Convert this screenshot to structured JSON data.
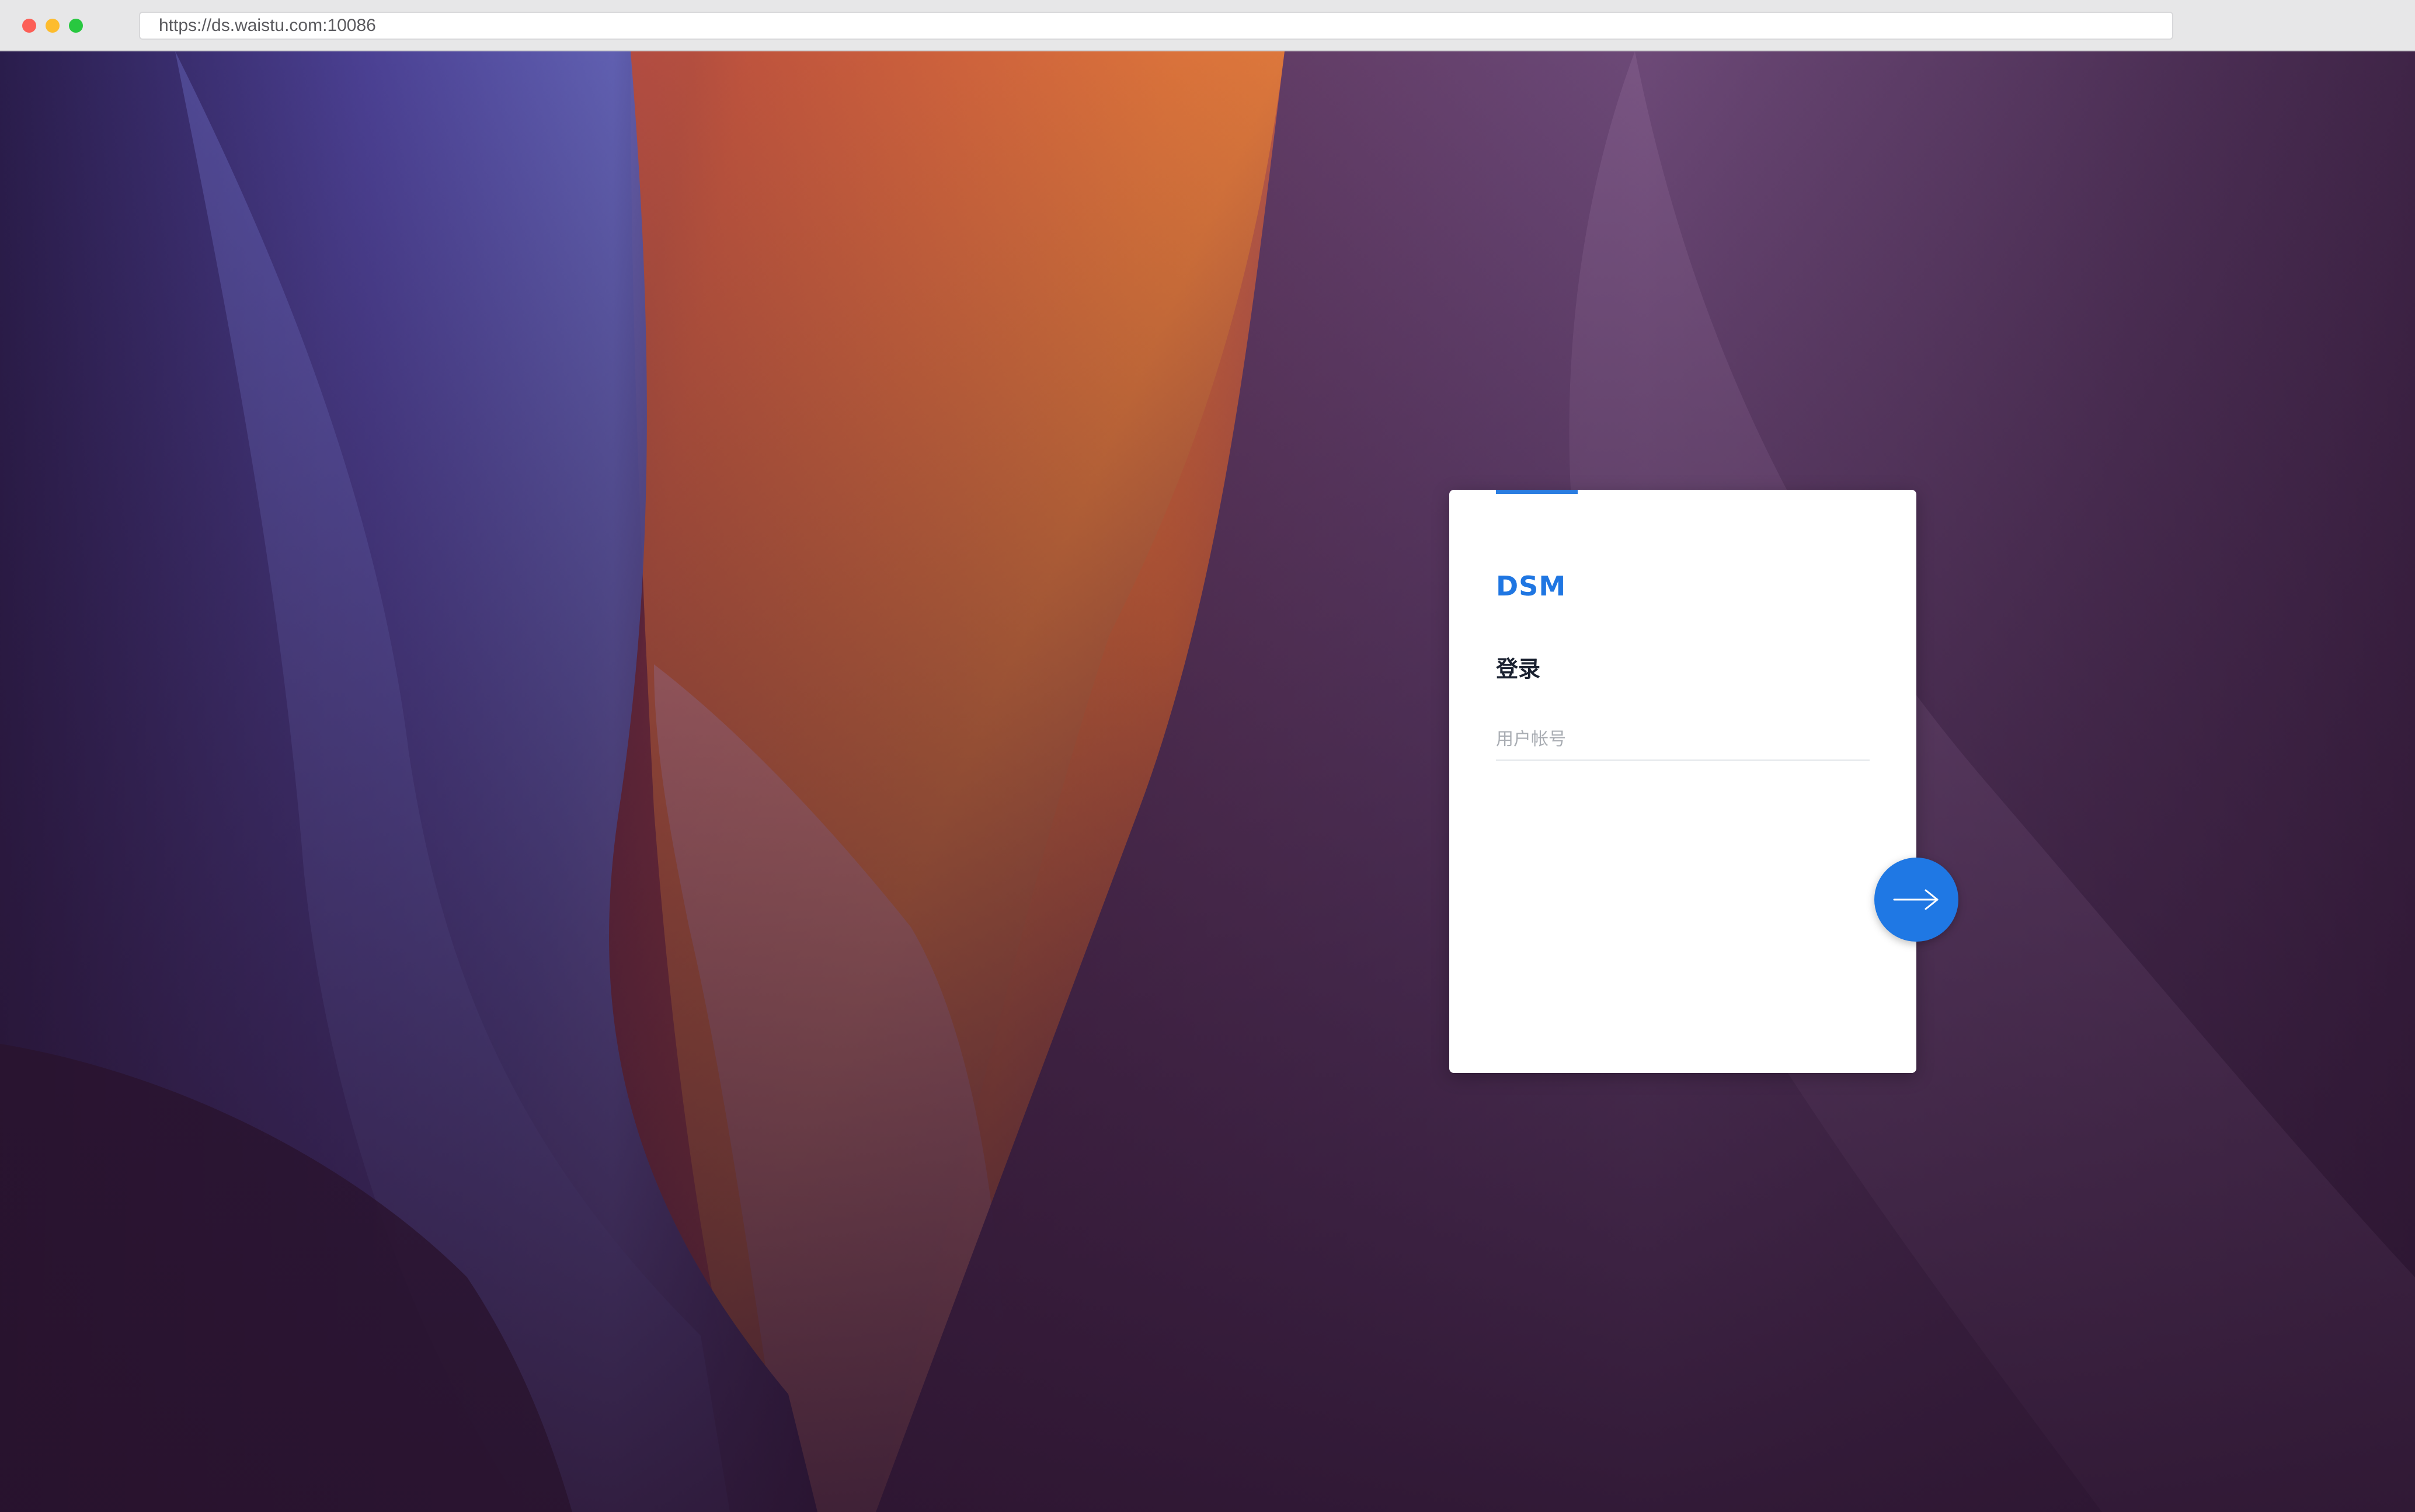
{
  "browser": {
    "url": "https://ds.waistu.com:10086"
  },
  "login": {
    "logo": "DSM",
    "title": "登录",
    "username_placeholder": "用户帐号",
    "username_value": ""
  },
  "colors": {
    "accent": "#1f78e4",
    "card_background": "#ffffff"
  },
  "icons": {
    "next": "arrow-right-icon"
  }
}
